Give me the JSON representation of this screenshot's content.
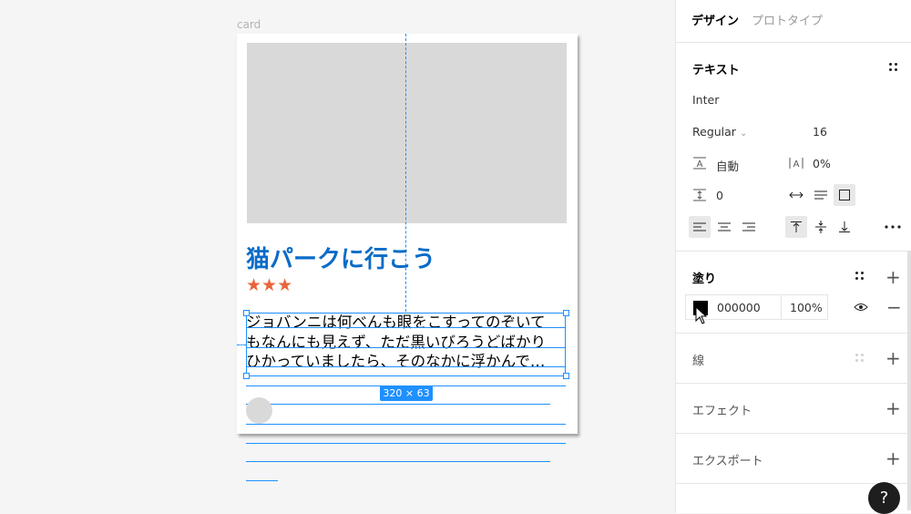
{
  "canvas": {
    "frame_label": "card",
    "card": {
      "title": "猫パークに行こう",
      "stars": "★★★",
      "body_lines": [
        "ジョバンニは何べんも眼をこすってのぞいて",
        "もなんにも見えず、ただ黒いびろうどばかり",
        "ひかっていましたら、そのなかに浮かんで…"
      ]
    },
    "size_badge": "320 × 63"
  },
  "panel": {
    "tabs": {
      "design": "デザイン",
      "prototype": "プロトタイプ"
    },
    "text_section": {
      "title": "テキスト",
      "font_family": "Inter",
      "font_weight": "Regular",
      "font_size": "16",
      "line_height": "自動",
      "letter_spacing": "0%",
      "paragraph_spacing": "0"
    },
    "fill_section": {
      "title": "塗り",
      "hex": "000000",
      "opacity": "100%"
    },
    "stroke_section": {
      "title": "線"
    },
    "effect_section": {
      "title": "エフェクト"
    },
    "export_section": {
      "title": "エクスポート"
    },
    "help": "?"
  },
  "colors": {
    "accent": "#1e90ff",
    "title_blue": "#0a6cc8",
    "star_orange": "#e8643c",
    "placeholder_gray": "#d9d9d9",
    "fill_color": "#000000"
  }
}
